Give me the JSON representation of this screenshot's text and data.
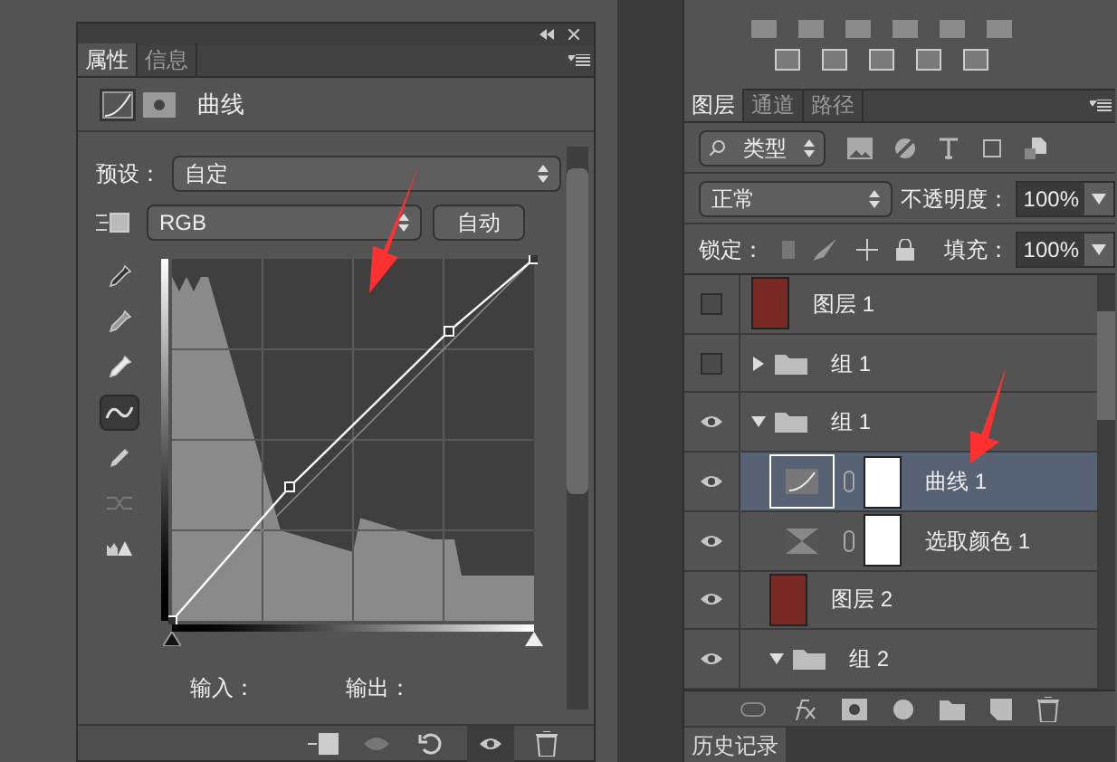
{
  "properties_panel": {
    "tabs": [
      {
        "label": "属性",
        "selected": true
      },
      {
        "label": "信息",
        "selected": false
      }
    ],
    "title": "曲线",
    "preset": {
      "label": "预设：",
      "value": "自定"
    },
    "channel": {
      "value": "RGB"
    },
    "auto_button": "自动",
    "tools": [
      {
        "kind": "eyedropper-black",
        "selected": false
      },
      {
        "kind": "eyedropper-gray",
        "selected": false
      },
      {
        "kind": "eyedropper-white",
        "selected": false
      },
      {
        "kind": "curve",
        "selected": true
      },
      {
        "kind": "pencil",
        "selected": false
      },
      {
        "kind": "smooth",
        "selected": false
      },
      {
        "kind": "clipping",
        "selected": false
      }
    ],
    "input_label": "输入：",
    "output_label": "输出："
  },
  "layers_panel": {
    "tabs": [
      {
        "label": "图层",
        "selected": true
      },
      {
        "label": "通道",
        "selected": false
      },
      {
        "label": "路径",
        "selected": false
      }
    ],
    "filter": "类型",
    "blend_mode": "正常",
    "opacity_label": "不透明度：",
    "opacity": "100%",
    "lock_label": "锁定：",
    "fill_label": "填充：",
    "fill": "100%",
    "layers": [
      {
        "kind": "pixel",
        "name": "图层 1",
        "visible": false,
        "selected": false
      },
      {
        "kind": "group",
        "name": "组 1",
        "visible": false,
        "selected": false,
        "expanded": false
      },
      {
        "kind": "group",
        "name": "组 1",
        "visible": true,
        "selected": false,
        "expanded": true,
        "children": [
          {
            "kind": "curves",
            "name": "曲线 1",
            "visible": true,
            "selected": true
          },
          {
            "kind": "selective-color",
            "name": "选取颜色 1",
            "visible": true,
            "selected": false
          },
          {
            "kind": "pixel",
            "name": "图层 2",
            "visible": true,
            "selected": false
          },
          {
            "kind": "group",
            "name": "组 2",
            "visible": true,
            "selected": false,
            "expanded": true
          }
        ]
      }
    ]
  },
  "history_tab": "历史记录"
}
